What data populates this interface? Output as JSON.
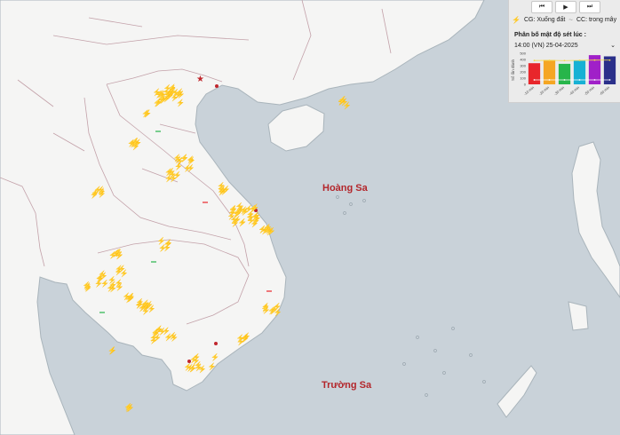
{
  "map": {
    "labels": {
      "paracel": "Hoàng Sa",
      "spratly": "Trường Sa"
    },
    "colors": {
      "sea": "#c9d2d9",
      "land": "#f5f5f4",
      "border": "#c3a1a9",
      "coast": "#a9b4bb",
      "label": "#b3262b"
    }
  },
  "panel": {
    "controls": [
      {
        "name": "skip-back-icon",
        "glyph": "⏮"
      },
      {
        "name": "play-icon",
        "glyph": "▶"
      },
      {
        "name": "skip-forward-icon",
        "glyph": "⏭"
      }
    ],
    "legend": {
      "cg_symbol": "⚡",
      "cg_label": "CG: Xuống đất",
      "cc_symbol": "~",
      "cc_label": "CC: trong mây"
    },
    "title": "Phân bố mật độ sét lúc :",
    "time_select": "14:00 (VN) 25-04-2025",
    "chevron": "⌄"
  },
  "chart_data": {
    "type": "bar",
    "ylabel": "Số lần đánh",
    "yticks": [
      "500",
      "400",
      "300",
      "200",
      "100",
      "0"
    ],
    "categories": [
      "-10 min",
      "-20 min",
      "-30 min",
      "-40 min",
      "-50 min",
      "-60 min"
    ],
    "values": [
      340,
      390,
      330,
      380,
      470,
      450
    ],
    "bar_colors": [
      "#e8262b",
      "#f5a623",
      "#27b54a",
      "#17b1d4",
      "#a020c8",
      "#2a2f8a"
    ],
    "ylim": [
      0,
      500
    ]
  }
}
